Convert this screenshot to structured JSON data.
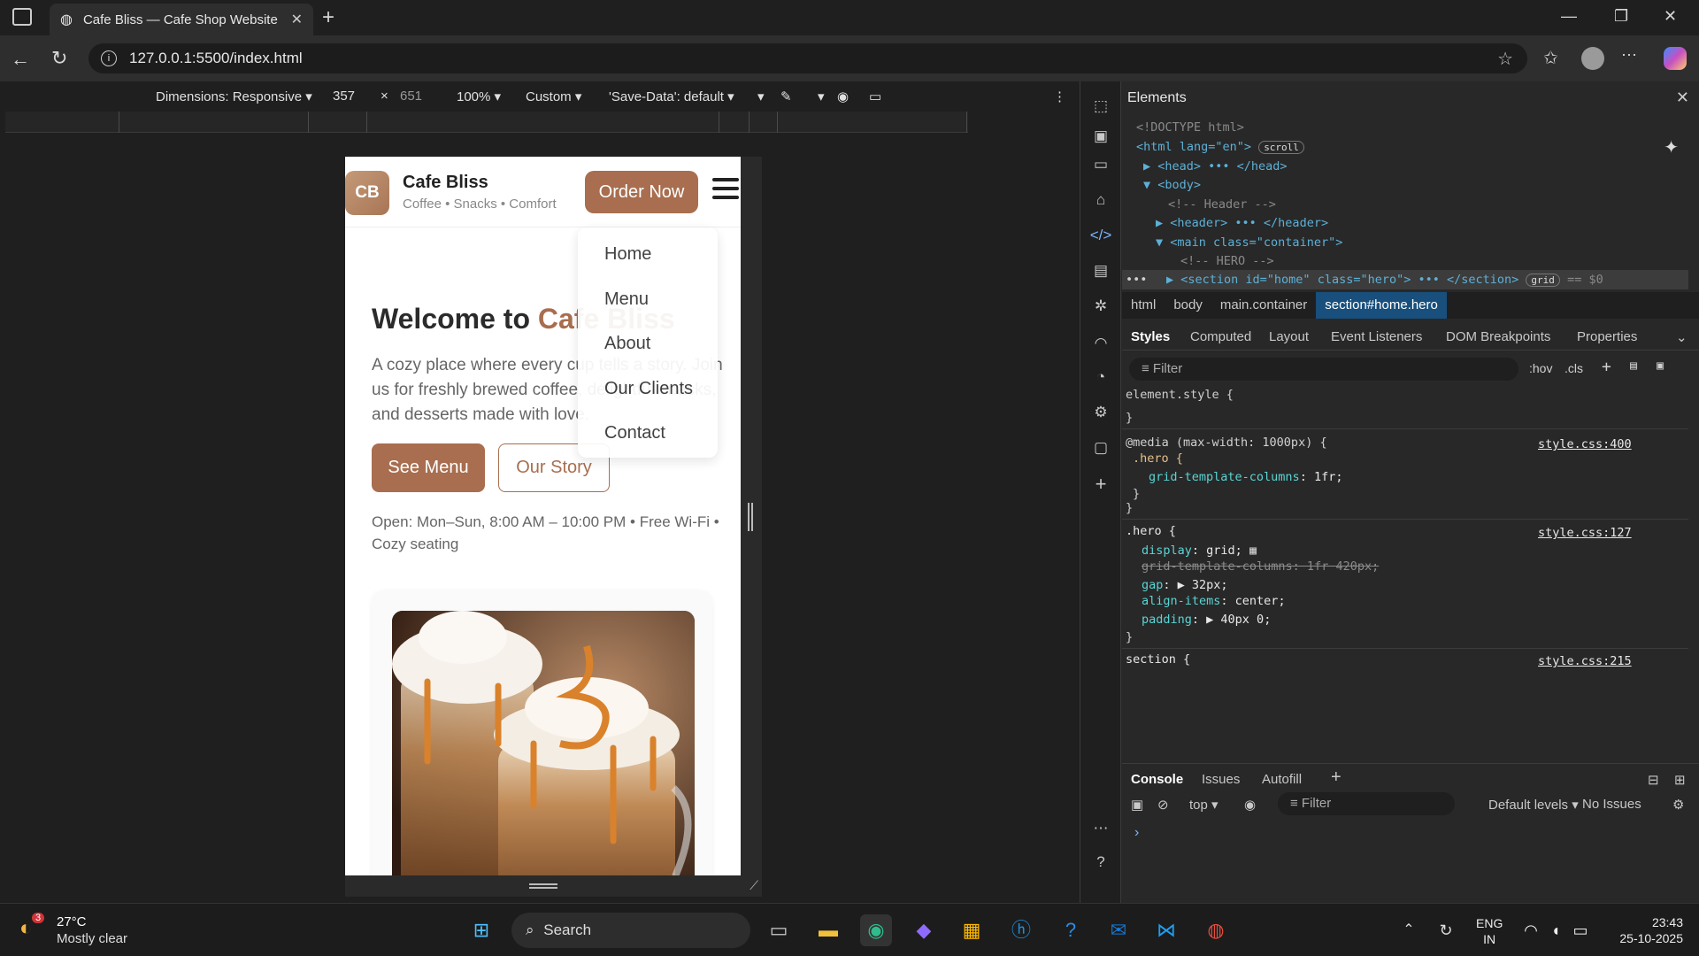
{
  "browser": {
    "tab_title": "Cafe Bliss — Cafe Shop Website",
    "url": "127.0.0.1:5500/index.html"
  },
  "device_toolbar": {
    "dimensions": "Dimensions: Responsive",
    "width": "357",
    "times": "×",
    "height": "651",
    "zoom": "100%",
    "throttle": "Custom",
    "save_data": "'Save-Data': default"
  },
  "site": {
    "logo_text": "CB",
    "brand": "Cafe Bliss",
    "tagline": "Coffee • Snacks • Comfort",
    "order_button": "Order Now",
    "hero_title_a": "Welcome to ",
    "hero_title_b": "Cafe Bliss",
    "hero_text": "A cozy place where every cup tells a story. Join us for freshly brewed coffee, delightful snacks, and desserts made with love.",
    "see_menu": "See Menu",
    "our_story": "Our Story",
    "hours": "Open: Mon–Sun, 8:00 AM – 10:00 PM • Free Wi-Fi • Cozy seating",
    "nav": [
      "Home",
      "Menu",
      "About",
      "Our Clients",
      "Contact"
    ]
  },
  "devtools": {
    "title": "Elements",
    "dom": {
      "doctype": "<!DOCTYPE html>",
      "html_open": "<html lang=\"en\">",
      "scroll_badge": "scroll",
      "head": "<head> ••• </head>",
      "body": "<body>",
      "comment_header": "<!-- Header -->",
      "header": "<header> ••• </header>",
      "main": "<main class=\"container\">",
      "comment_hero": "<!-- HERO -->",
      "section": "<section id=\"home\" class=\"hero\"> ••• </section>",
      "grid_badge": "grid",
      "eq": "== $0"
    },
    "breadcrumbs": [
      "html",
      "body",
      "main.container",
      "section#home.hero"
    ],
    "style_tabs": [
      "Styles",
      "Computed",
      "Layout",
      "Event Listeners",
      "DOM Breakpoints",
      "Properties"
    ],
    "filter_placeholder": "Filter",
    "hov": ":hov",
    "cls": ".cls",
    "rules": {
      "element_style": "element.style {",
      "close": "}",
      "media": "@media (max-width: 1000px) {",
      "media_sel": ".hero {",
      "media_prop": "grid-template-columns",
      "media_val": "1fr;",
      "media_src": "style.css:400",
      "hero_sel": ".hero {",
      "hero_src": "style.css:127",
      "p1": "display",
      "v1": "grid;",
      "p2": "grid-template-columns: 1fr 420px;",
      "p3": "gap",
      "v3": "32px;",
      "p4": "align-items",
      "v4": "center;",
      "p5": "padding",
      "v5": "40px 0;",
      "section_sel": "section {",
      "section_src": "style.css:215"
    },
    "console_tabs": [
      "Console",
      "Issues",
      "Autofill"
    ],
    "console_context": "top",
    "console_filter": "Filter",
    "levels": "Default levels",
    "issues": "No Issues"
  },
  "taskbar": {
    "weather_temp": "27°C",
    "weather_desc": "Mostly clear",
    "weather_badge": "3",
    "search": "Search",
    "lang": "ENG",
    "region": "IN",
    "time": "23:43",
    "date": "25-10-2025"
  }
}
